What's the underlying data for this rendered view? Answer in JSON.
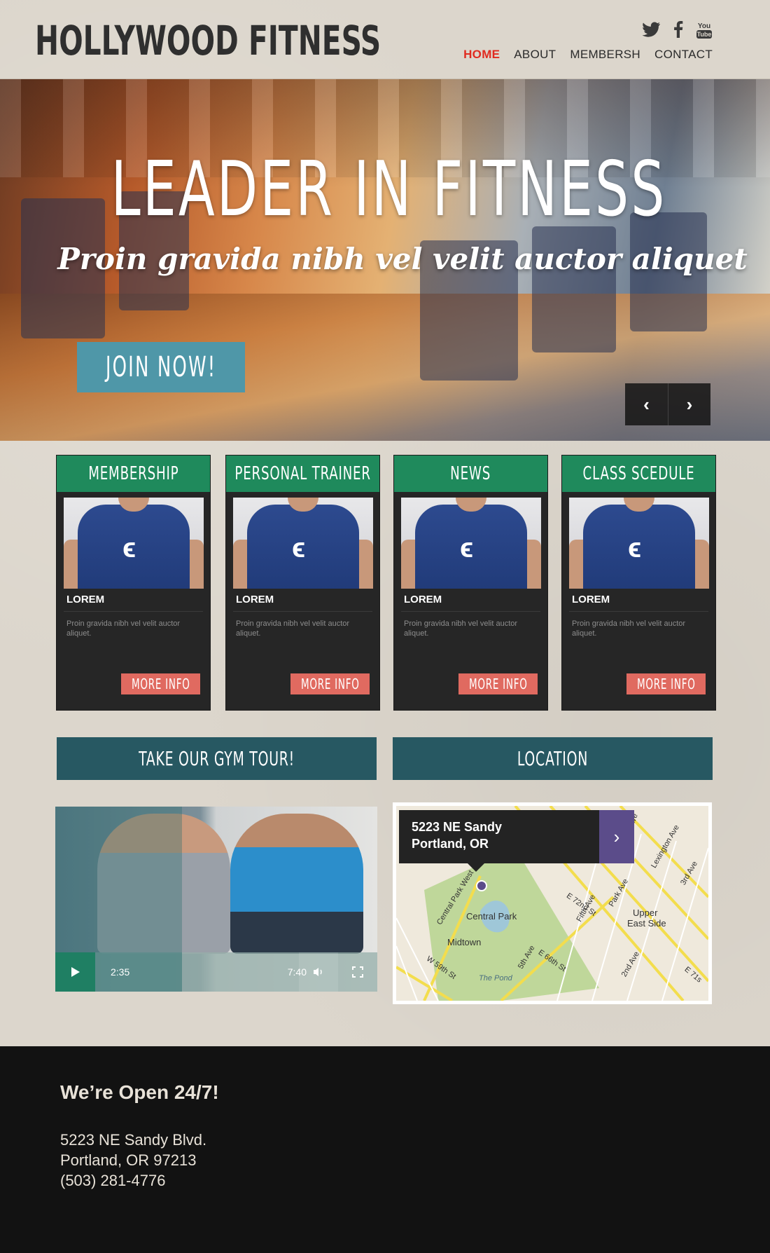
{
  "header": {
    "logo": "HOLLYWOOD FITNESS",
    "social": {
      "twitter": "twitter-icon",
      "facebook": "facebook-icon",
      "youtube_label": "You Tube"
    },
    "nav": [
      {
        "label": "HOME",
        "active": true
      },
      {
        "label": "ABOUT",
        "active": false
      },
      {
        "label": "MEMBERSH",
        "active": false
      },
      {
        "label": "CONTACT",
        "active": false
      }
    ]
  },
  "hero": {
    "title": "LEADER IN FITNESS",
    "subtitle": "Proin gravida nibh vel velit auctor aliquet",
    "cta": "JOIN NOW!",
    "prev_glyph": "‹",
    "next_glyph": "›"
  },
  "cards": [
    {
      "title": "MEMBERSHIP",
      "label": "LOREM",
      "text": "Proin gravida nibh vel velit auctor aliquet.",
      "button": "MORE INFO"
    },
    {
      "title": "PERSONAL TRAINER",
      "label": "LOREM",
      "text": "Proin gravida nibh vel velit auctor aliquet.",
      "button": "MORE INFO"
    },
    {
      "title": "NEWS",
      "label": "LOREM",
      "text": "Proin gravida nibh vel velit auctor aliquet.",
      "button": "MORE INFO"
    },
    {
      "title": "CLASS SCEDULE",
      "label": "LOREM",
      "text": "Proin gravida nibh vel velit auctor aliquet.",
      "button": "MORE INFO"
    }
  ],
  "tour": {
    "title": "TAKE OUR GYM TOUR!",
    "current_time": "2:35",
    "total_time": "7:40"
  },
  "location": {
    "title": "LOCATION",
    "address_line1": "5223 NE Sandy",
    "address_line2": "Portland, OR",
    "map_labels": {
      "central_park": "Central Park",
      "midtown": "Midtown",
      "upper_east_side_1": "Upper",
      "upper_east_side_2": "East Side",
      "the_pond": "The Pond",
      "fifth_ave": "Fifth Ave",
      "park_ave": "Park Ave",
      "lexington_ave": "Lexington Ave",
      "third_ave": "3rd Ave",
      "central_park_west": "Central Park West",
      "w59": "W 59th St",
      "e72": "E 72nd St",
      "e66": "E 66th St",
      "fifth_ave_2": "5th Ave",
      "second_ave": "2nd Ave",
      "madison_ave": "Madison Ave",
      "e71": "E 71s"
    }
  },
  "footer": {
    "heading": "We’re Open 24/7!",
    "address1": "5223 NE Sandy Blvd.",
    "address2": "Portland, OR 97213",
    "phone": "(503) 281-4776"
  },
  "colors": {
    "accent_red": "#e02b20",
    "card_green": "#1f8a5c",
    "section_teal": "#275862",
    "button_coral": "#e06a60",
    "join_blue": "#4f97a8",
    "map_purple": "#5b4c8a"
  }
}
